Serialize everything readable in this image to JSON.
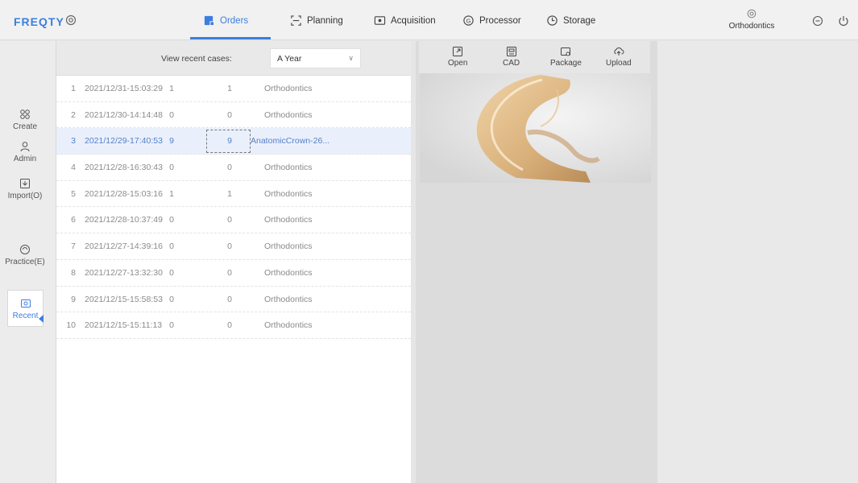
{
  "app": {
    "logo": "FREQTY"
  },
  "tabs": [
    {
      "label": "Orders",
      "icon": "orders-icon",
      "active": true
    },
    {
      "label": "Planning",
      "icon": "planning-icon"
    },
    {
      "label": "Acquisition",
      "icon": "acquisition-icon"
    },
    {
      "label": "Processor",
      "icon": "processor-icon"
    },
    {
      "label": "Storage",
      "icon": "storage-icon"
    }
  ],
  "profile": {
    "label": "Orthodontics",
    "icon": "settings-icon"
  },
  "sidebar": {
    "items": [
      {
        "label": "Create",
        "icon": "create-icon"
      },
      {
        "label": "Admin",
        "icon": "admin-icon"
      },
      {
        "label": "Import(O)",
        "icon": "import-icon"
      },
      {
        "label": "Practice(E)",
        "icon": "practice-icon"
      },
      {
        "label": "Recent",
        "icon": "recent-icon",
        "active": true
      }
    ]
  },
  "filter": {
    "label": "View recent cases:",
    "value": "A Year"
  },
  "cases": [
    {
      "num": "1",
      "date": "2021/12/31-15:03:29",
      "a": "1",
      "b": "1",
      "type": "Orthodontics"
    },
    {
      "num": "2",
      "date": "2021/12/30-14:14:48",
      "a": "0",
      "b": "0",
      "type": "Orthodontics"
    },
    {
      "num": "3",
      "date": "2021/12/29-17:40:53",
      "a": "9",
      "b": "9",
      "type": "AnatomicCrown-26...",
      "selected": true
    },
    {
      "num": "4",
      "date": "2021/12/28-16:30:43",
      "a": "0",
      "b": "0",
      "type": "Orthodontics"
    },
    {
      "num": "5",
      "date": "2021/12/28-15:03:16",
      "a": "1",
      "b": "1",
      "type": "Orthodontics"
    },
    {
      "num": "6",
      "date": "2021/12/28-10:37:49",
      "a": "0",
      "b": "0",
      "type": "Orthodontics"
    },
    {
      "num": "7",
      "date": "2021/12/27-14:39:16",
      "a": "0",
      "b": "0",
      "type": "Orthodontics"
    },
    {
      "num": "8",
      "date": "2021/12/27-13:32:30",
      "a": "0",
      "b": "0",
      "type": "Orthodontics"
    },
    {
      "num": "9",
      "date": "2021/12/15-15:58:53",
      "a": "0",
      "b": "0",
      "type": "Orthodontics"
    },
    {
      "num": "10",
      "date": "2021/12/15-15:11:13",
      "a": "0",
      "b": "0",
      "type": "Orthodontics"
    }
  ],
  "toolbar": {
    "open": "Open",
    "cad": "CAD",
    "package": "Package",
    "upload": "Upload"
  },
  "colors": {
    "accent": "#3c7ee0",
    "selected_row": "#eaf0fb"
  }
}
